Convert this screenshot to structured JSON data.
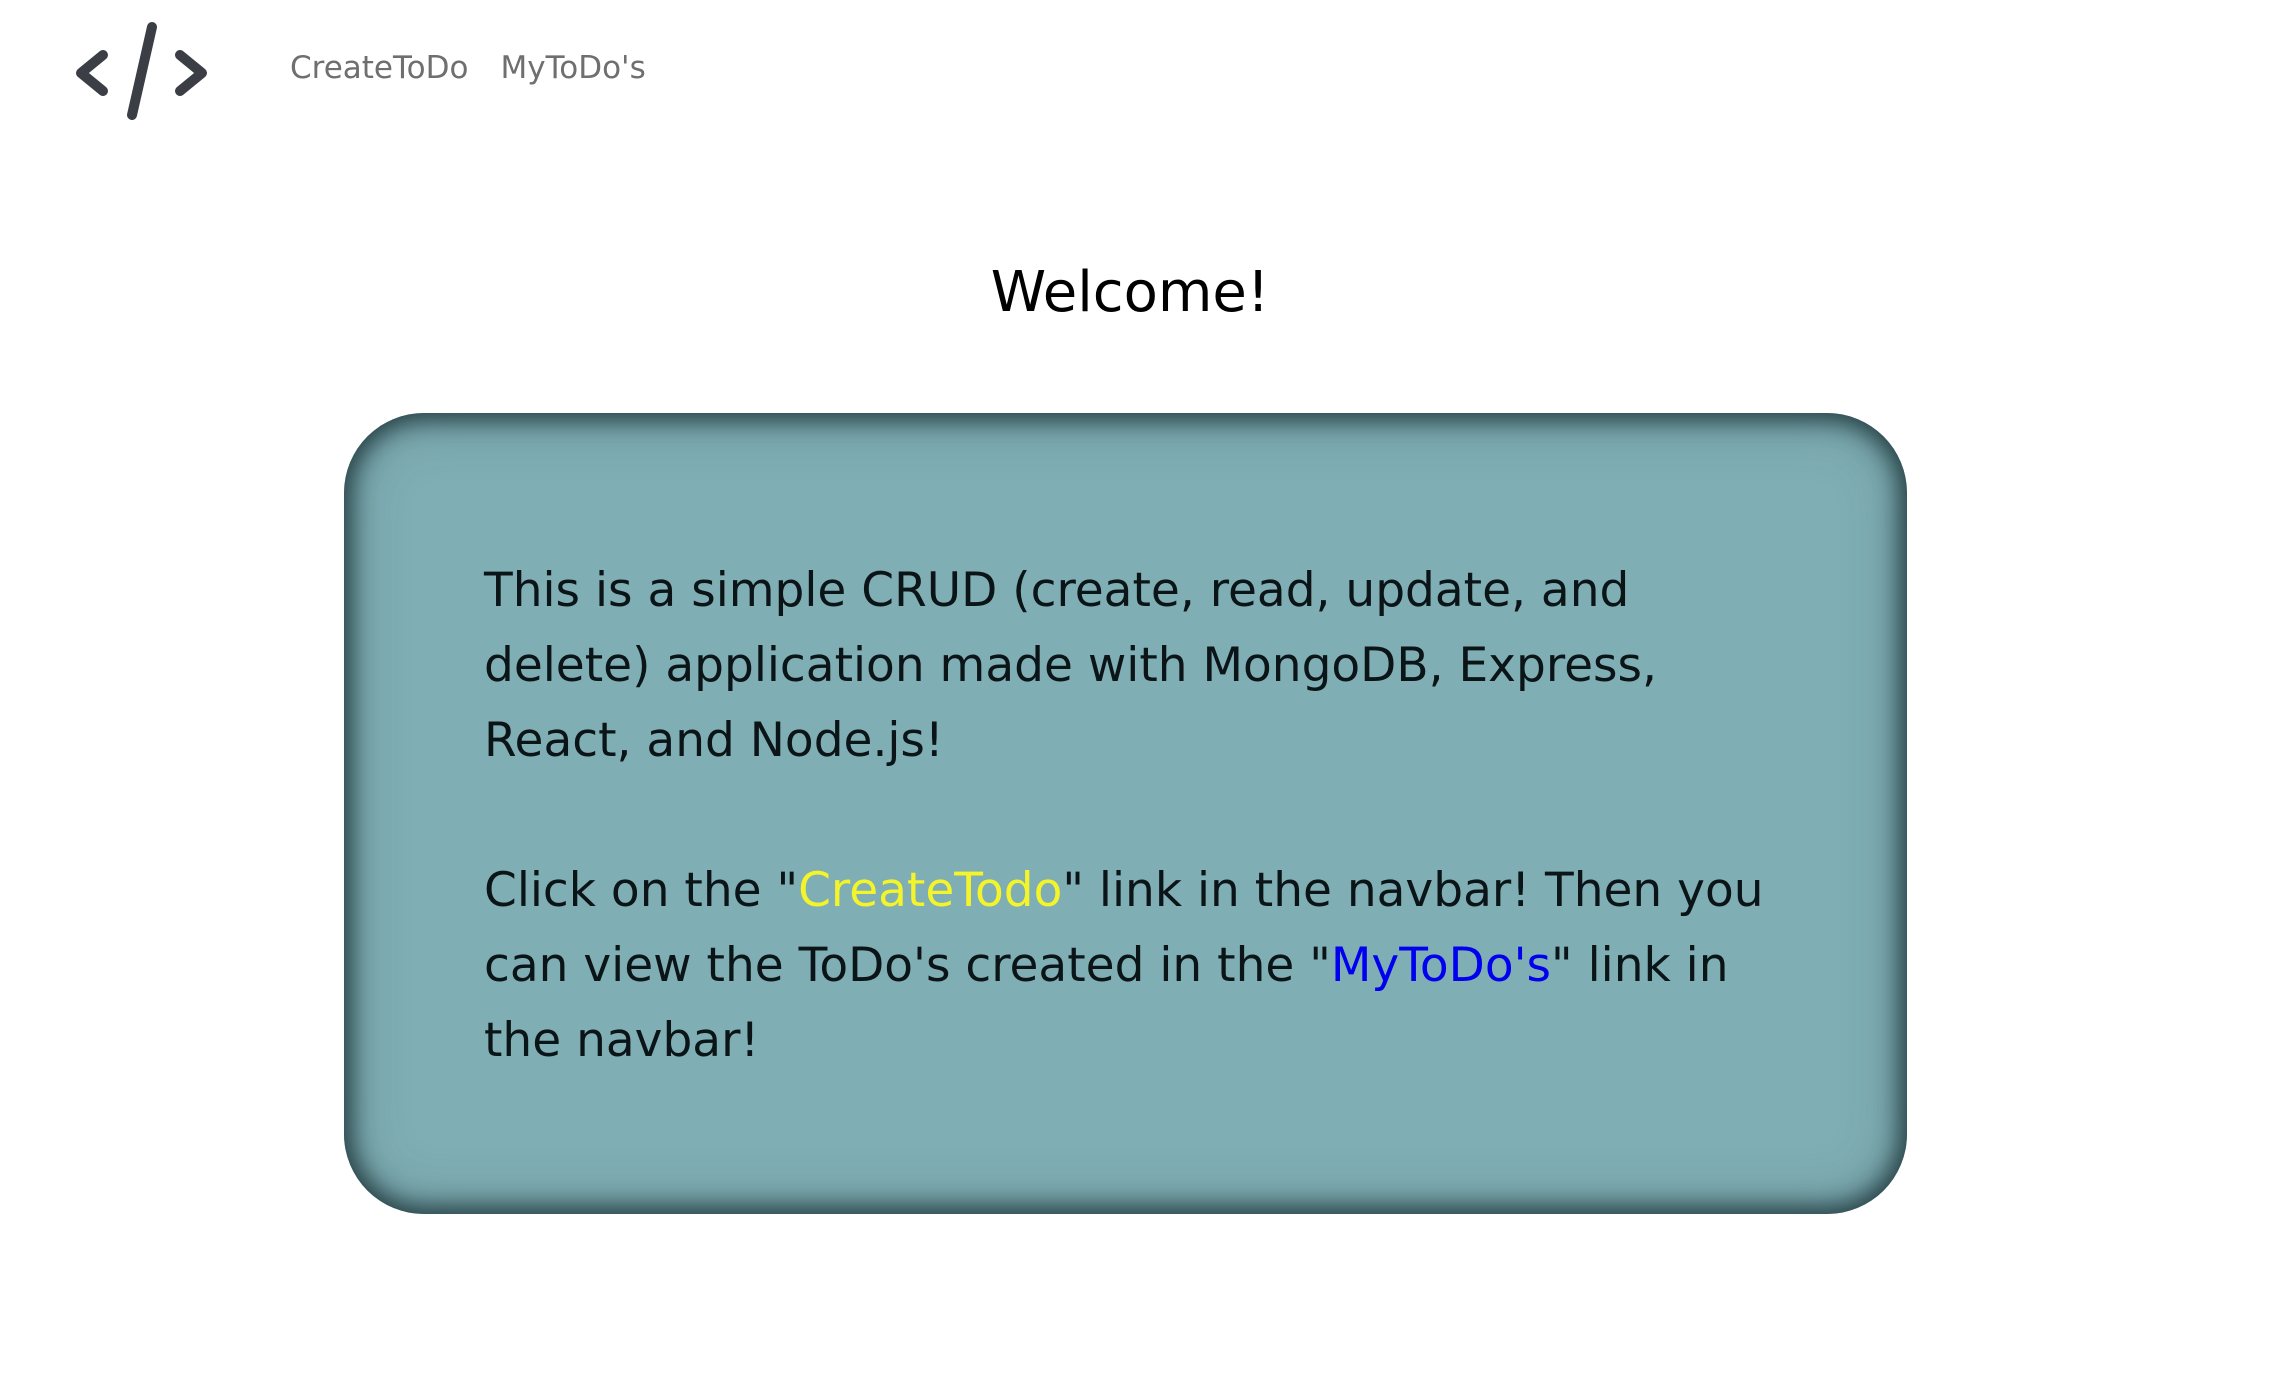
{
  "navbar": {
    "logo_icon": "code-icon",
    "links": [
      {
        "label": "CreateToDo"
      },
      {
        "label": "MyToDo's"
      }
    ]
  },
  "main": {
    "title": "Welcome!",
    "card": {
      "paragraph1": "This is a simple CRUD (create, read, update, and delete) application made with MongoDB, Express, React, and Node.js!",
      "paragraph2": {
        "before": "Click on the \"",
        "link1": "CreateTodo",
        "middle": "\" link in the navbar! Then you can view the ToDo's created in the \"",
        "link2": "MyToDo's",
        "after": "\" link in the navbar!"
      }
    }
  },
  "colors": {
    "card_background": "#7faeb4",
    "link_create": "#f4f42a",
    "link_mytodos": "#0000ee",
    "nav_text": "#6f6f6f"
  }
}
